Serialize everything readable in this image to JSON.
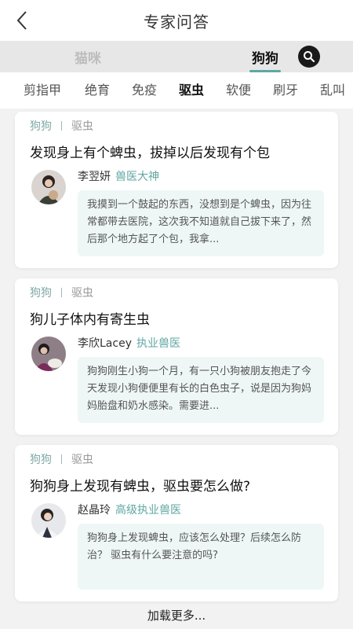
{
  "header": {
    "title": "专家问答",
    "back_icon": "chevron-left-icon"
  },
  "pet_tabs": {
    "items": [
      {
        "label": "猫咪",
        "active": false
      },
      {
        "label": "狗狗",
        "active": true
      }
    ],
    "search_icon": "search-icon"
  },
  "category_tabs": {
    "items": [
      "剪指甲",
      "绝育",
      "免疫",
      "驱虫",
      "软便",
      "刷牙",
      "乱叫"
    ],
    "active": "驱虫"
  },
  "colors": {
    "accent": "#5fa7a3",
    "answer_bg": "#eef7f6",
    "tag": "#7fa9a6"
  },
  "cards": [
    {
      "tag_pet": "狗狗",
      "tag_topic": "驱虫",
      "question": "发现身上有个蜱虫，拔掉以后发现有个包",
      "expert_name": "李翌妍",
      "expert_title": "兽医大神",
      "answer": "我摸到一个鼓起的东西，没想到是个蜱虫，因为往常都带去医院，这次我不知道就自己拔下来了，然后那个地方起了个包，我拿..."
    },
    {
      "tag_pet": "狗狗",
      "tag_topic": "驱虫",
      "question": "狗儿子体内有寄生虫",
      "expert_name": "李欣Lacey",
      "expert_title": "执业兽医",
      "answer": "狗狗刚生小狗一个月，有一只小狗被朋友抱走了今天发现小狗便便里有长的白色虫子，说是因为狗妈妈胎盘和奶水感染。需要进..."
    },
    {
      "tag_pet": "狗狗",
      "tag_topic": "驱虫",
      "question": "狗狗身上发现有蜱虫，驱虫要怎么做?",
      "expert_name": "赵晶玲",
      "expert_title": "高级执业兽医",
      "answer": "狗狗身上发现蜱虫，应该怎么处理？后续怎么防治？ 驱虫有什么要注意的吗?"
    }
  ],
  "load_more": "加载更多..."
}
